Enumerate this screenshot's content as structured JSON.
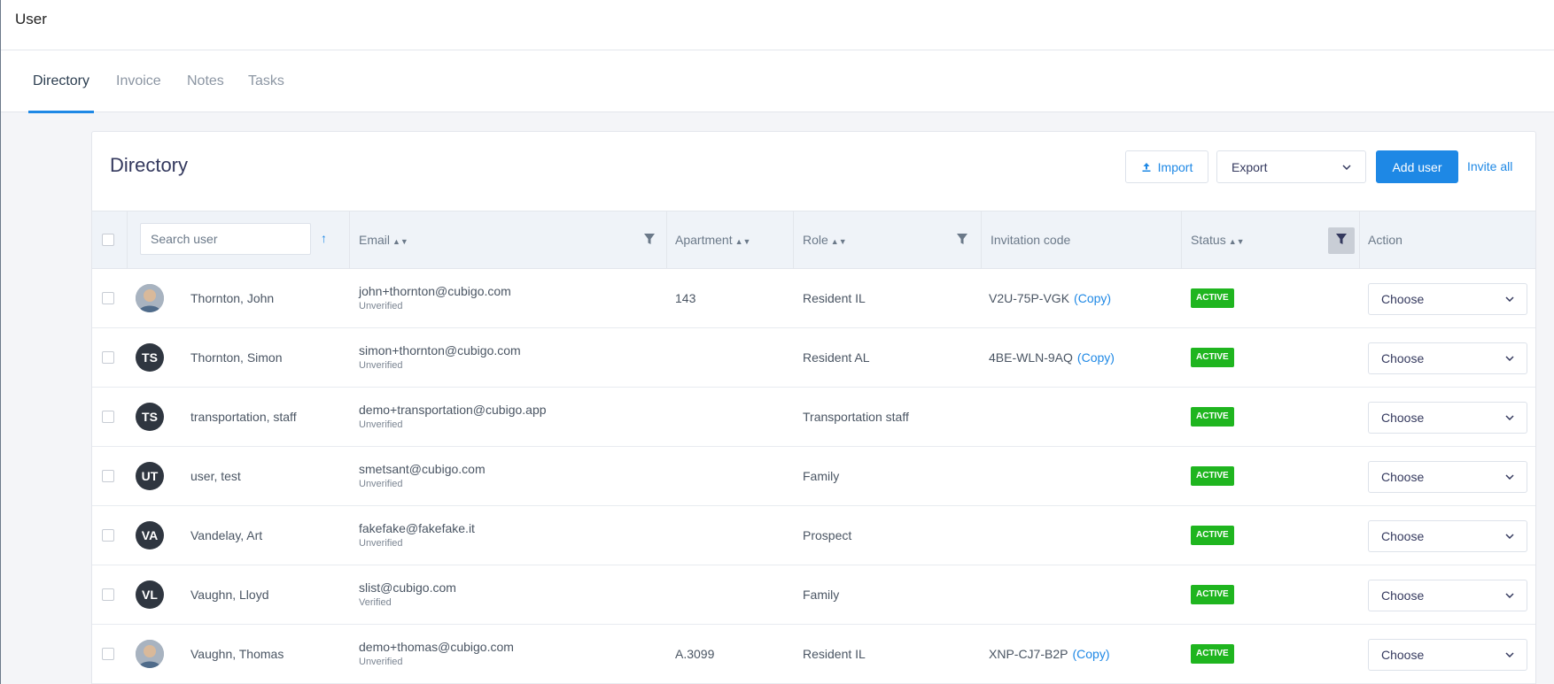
{
  "header": {
    "title": "User"
  },
  "tabs": [
    {
      "label": "Directory",
      "active": true
    },
    {
      "label": "Invoice"
    },
    {
      "label": "Notes"
    },
    {
      "label": "Tasks"
    }
  ],
  "card": {
    "title": "Directory",
    "import_label": "Import",
    "export_label": "Export",
    "add_user_label": "Add user",
    "invite_all_label": "Invite all"
  },
  "table": {
    "search_placeholder": "Search user",
    "columns": {
      "email": "Email",
      "apartment": "Apartment",
      "role": "Role",
      "invitation_code": "Invitation code",
      "status": "Status",
      "action": "Action"
    },
    "copy_label": "(Copy)",
    "action_placeholder": "Choose",
    "rows": [
      {
        "initials": "",
        "avatar_photo": true,
        "name": "Thornton, John",
        "email": "john+thornton@cubigo.com",
        "email_status": "Unverified",
        "apartment": "143",
        "role": "Resident IL",
        "code": "V2U-75P-VGK",
        "status": "ACTIVE"
      },
      {
        "initials": "TS",
        "name": "Thornton, Simon",
        "email": "simon+thornton@cubigo.com",
        "email_status": "Unverified",
        "apartment": "",
        "role": "Resident AL",
        "code": "4BE-WLN-9AQ",
        "status": "ACTIVE"
      },
      {
        "initials": "TS",
        "name": "transportation, staff",
        "email": "demo+transportation@cubigo.app",
        "email_status": "Unverified",
        "apartment": "",
        "role": "Transportation staff",
        "code": "",
        "status": "ACTIVE"
      },
      {
        "initials": "UT",
        "name": "user, test",
        "email": "smetsant@cubigo.com",
        "email_status": "Unverified",
        "apartment": "",
        "role": "Family",
        "code": "",
        "status": "ACTIVE"
      },
      {
        "initials": "VA",
        "name": "Vandelay, Art",
        "email": "fakefake@fakefake.it",
        "email_status": "Unverified",
        "apartment": "",
        "role": "Prospect",
        "code": "",
        "status": "ACTIVE"
      },
      {
        "initials": "VL",
        "name": "Vaughn, Lloyd",
        "email": "slist@cubigo.com",
        "email_status": "Verified",
        "apartment": "",
        "role": "Family",
        "code": "",
        "status": "ACTIVE"
      },
      {
        "initials": "",
        "avatar_photo": true,
        "name": "Vaughn, Thomas",
        "email": "demo+thomas@cubigo.com",
        "email_status": "Unverified",
        "apartment": "A.3099",
        "role": "Resident IL",
        "code": "XNP-CJ7-B2P",
        "status": "ACTIVE"
      }
    ]
  },
  "colors": {
    "accent": "#1e88e5",
    "active_badge": "#1fb51f",
    "avatar_bg": "#2f3640"
  },
  "icons": {
    "import": "upload-icon",
    "sort": "sort-icon",
    "filter": "filter-icon",
    "chevron": "chevron-down-icon"
  }
}
